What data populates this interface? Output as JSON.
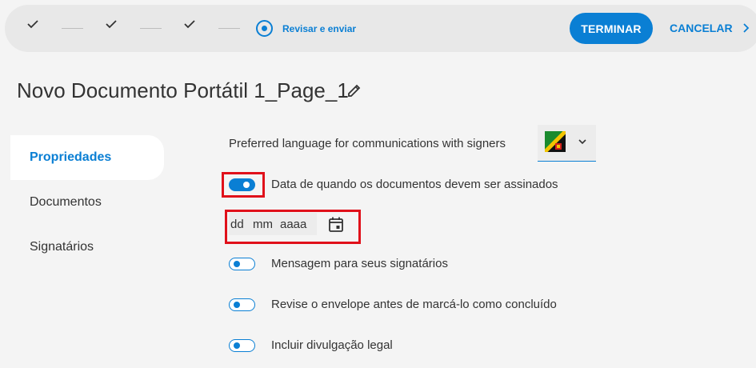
{
  "steps": {
    "current_label": "Revisar e enviar"
  },
  "header": {
    "finish_label": "TERMINAR",
    "cancel_label": "CANCELAR"
  },
  "page": {
    "title": "Novo Documento Portátil 1_Page_1"
  },
  "sidebar": {
    "items": [
      {
        "label": "Propriedades",
        "active": true
      },
      {
        "label": "Documentos",
        "active": false
      },
      {
        "label": "Signatários",
        "active": false
      }
    ]
  },
  "content": {
    "language_label": "Preferred language for communications with signers",
    "sign_date_toggle": {
      "label": "Data de quando os documentos devem ser assinados",
      "on": true
    },
    "date_input": {
      "day": "dd",
      "month": "mm",
      "year": "aaaa"
    },
    "message_toggle": {
      "label": "Mensagem para seus signatários",
      "on": false
    },
    "review_toggle": {
      "label": "Revise o envelope antes de marcá-lo como concluído",
      "on": false
    },
    "legal_toggle": {
      "label": "Incluir divulgação legal",
      "on": false
    }
  },
  "colors": {
    "accent": "#0a7fd4",
    "highlight": "#e0101a"
  }
}
